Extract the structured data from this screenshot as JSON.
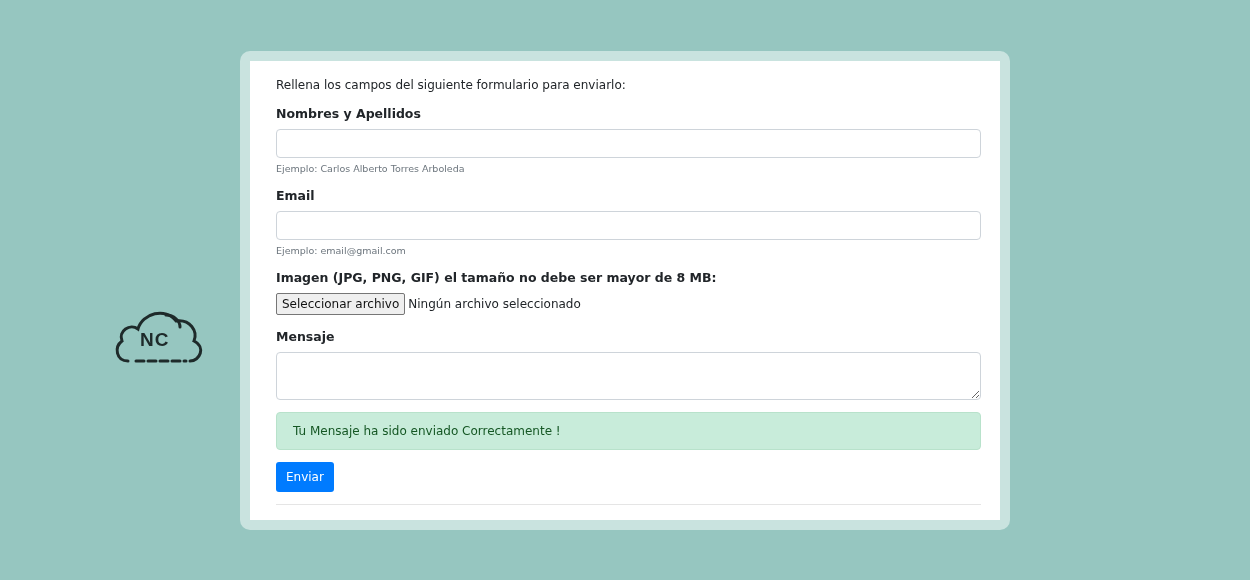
{
  "logo": {
    "text": "NC"
  },
  "form": {
    "intro": "Rellena los campos del siguiente formulario para enviarlo:",
    "fields": [
      {
        "kind": "text",
        "label": "Nombres y Apellidos",
        "help": "Ejemplo: Carlos Alberto Torres Arboleda"
      },
      {
        "kind": "text",
        "label": "Email",
        "help": "Ejemplo: email@gmail.com"
      },
      {
        "kind": "file",
        "label": "Imagen (JPG, PNG, GIF) el tamaño no debe ser mayor de 8 MB:",
        "button": "Seleccionar archivo",
        "status": "Ningún archivo seleccionado"
      },
      {
        "kind": "textarea",
        "label": "Mensaje"
      }
    ],
    "alert": "Tu Mensaje ha sido enviado Correctamente !",
    "submit": "Enviar"
  }
}
